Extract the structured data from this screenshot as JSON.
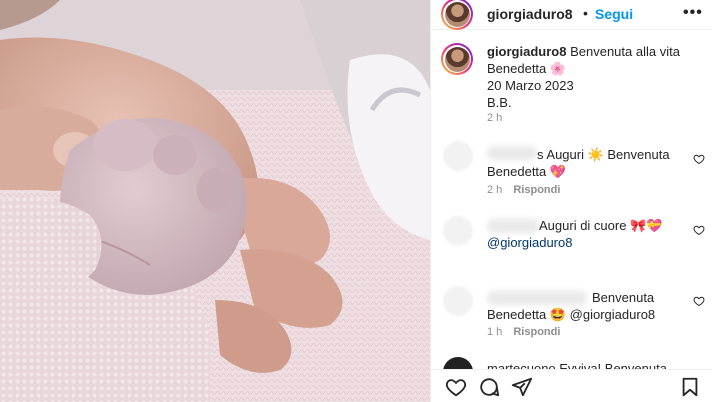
{
  "header": {
    "username": "giorgiaduro8",
    "separator": "•",
    "follow_label": "Segui",
    "more_label": "•••"
  },
  "caption": {
    "username": "giorgiaduro8",
    "line1": "Benvenuta alla vita",
    "line2": "Benedetta 🌸",
    "line3": "20 Marzo 2023",
    "line4": "B.B.",
    "time": "2 h"
  },
  "comments": [
    {
      "text_line1": "s Auguri ☀️ Benvenuta",
      "text_line2": "Benedetta 💖",
      "time": "2 h",
      "reply_label": "Rispondi"
    },
    {
      "text_line1": "Auguri di cuore 🎀💝",
      "text_line2": "@giorgiaduro8",
      "time": "",
      "reply_label": ""
    },
    {
      "text_line1": "Benvenuta",
      "text_line2": "Benedetta 🤩 @giorgiaduro8",
      "time": "1 h",
      "reply_label": "Rispondi"
    },
    {
      "text_line1": "martecuono Evviva! Benvenuta",
      "text_line2": "",
      "time": "",
      "reply_label": ""
    }
  ],
  "colors": {
    "accent": "#0095f6",
    "text": "#262626",
    "muted": "#8e8e8e",
    "mention": "#00376b"
  },
  "icons": [
    "heart-icon",
    "comment-icon",
    "share-icon",
    "bookmark-icon",
    "more-icon"
  ]
}
